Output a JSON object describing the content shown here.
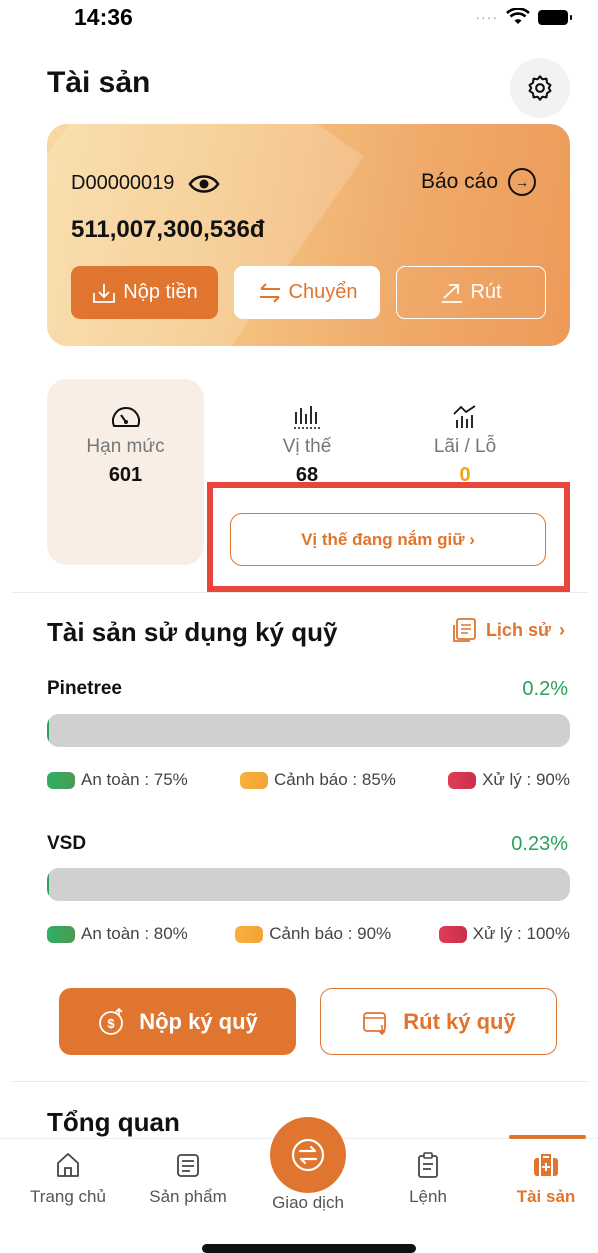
{
  "status_bar": {
    "time": "14:36"
  },
  "header": {
    "title": "Tài sản"
  },
  "account": {
    "id": "D00000019",
    "report_label": "Báo cáo",
    "balance": "511,007,300,536đ",
    "deposit_label": "Nộp tiền",
    "transfer_label": "Chuyển",
    "withdraw_label": "Rút"
  },
  "stats": {
    "limit": {
      "label": "Hạn mức",
      "value": "601"
    },
    "position": {
      "label": "Vị thế",
      "value": "68"
    },
    "pnl": {
      "label": "Lãi / Lỗ",
      "value": "0"
    },
    "holding_button": "Vị thế đang nắm giữ ›"
  },
  "margin": {
    "title": "Tài sản sử dụng ký quỹ",
    "history_label": "Lịch sử",
    "accounts": [
      {
        "name": "Pinetree",
        "percent_label": "0.2%",
        "fill_percent": 0.2,
        "legend": [
          "An toàn : 75%",
          "Cảnh báo : 85%",
          "Xử lý : 90%"
        ]
      },
      {
        "name": "VSD",
        "percent_label": "0.23%",
        "fill_percent": 0.23,
        "legend": [
          "An toàn : 80%",
          "Cảnh báo : 90%",
          "Xử lý : 100%"
        ]
      }
    ],
    "deposit_button": "Nộp ký quỹ",
    "withdraw_button": "Rút ký quỹ"
  },
  "overview": {
    "title": "Tổng quan"
  },
  "bottom_nav": {
    "items": [
      {
        "label": "Trang chủ",
        "icon": "home-icon"
      },
      {
        "label": "Sản phẩm",
        "icon": "product-icon"
      },
      {
        "label": "Giao dịch",
        "icon": "exchange-icon"
      },
      {
        "label": "Lệnh",
        "icon": "order-icon"
      },
      {
        "label": "Tài sản",
        "icon": "assets-icon"
      }
    ],
    "active": "Tài sản"
  },
  "colors": {
    "accent": "#e0752f",
    "positive": "#27a35a",
    "highlight": "#e8453c"
  }
}
